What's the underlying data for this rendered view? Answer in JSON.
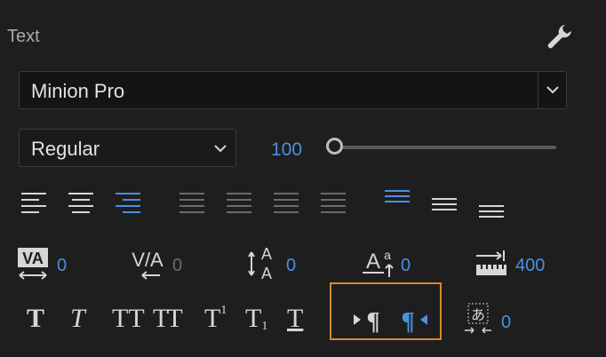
{
  "panel": {
    "title": "Text"
  },
  "font": {
    "family": "Minion Pro",
    "style": "Regular",
    "size": "100"
  },
  "colors": {
    "accent": "#4a90e2",
    "highlight_border": "#d58a2c",
    "icon": "#d6d6d6",
    "disabled": "#6b6b6b"
  },
  "icons": {
    "settings": "wrench-icon",
    "align": [
      "align-left-icon",
      "align-center-icon",
      "align-right-icon",
      "justify-last-left-icon",
      "justify-last-center-icon",
      "justify-last-right-icon",
      "justify-all-icon",
      "align-top-icon",
      "align-middle-icon",
      "align-bottom-icon"
    ]
  },
  "spacing": {
    "tracking": "0",
    "kerning": "0",
    "leading": "0",
    "baseline_shift": "0",
    "tab_width": "400",
    "tsume": "0"
  },
  "typography": {
    "faux_bold": "T",
    "faux_italic": "T",
    "all_caps": "TT",
    "small_caps": "TT",
    "superscript": "T",
    "superscript_mark": "1",
    "subscript": "T",
    "subscript_mark": "1",
    "underline": "T"
  },
  "direction": {
    "ltr": "ltr-text-icon",
    "rtl": "rtl-text-icon",
    "selected": "rtl"
  }
}
